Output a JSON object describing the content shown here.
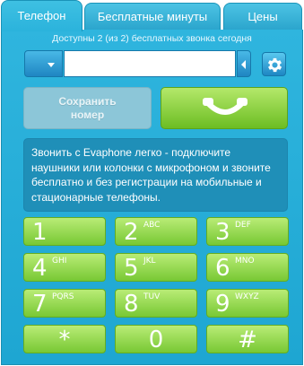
{
  "tabs": [
    {
      "label": "Телефон",
      "active": true
    },
    {
      "label": "Бесплатные минуты",
      "active": false
    },
    {
      "label": "Цены",
      "active": false
    }
  ],
  "quota_text": "Доступны 2 (из 2) бесплатных звонка сегодня",
  "dialer": {
    "number_value": "",
    "number_placeholder": ""
  },
  "save_button": {
    "line1": "Сохранить",
    "line2": "номер"
  },
  "info_text": "Звонить с Evaphone легко - подключите наушники или колонки с микрофоном и звоните бесплатно и без регистрации на мобильные и стационарные телефоны.",
  "keypad": [
    {
      "digit": "1",
      "letters": ""
    },
    {
      "digit": "2",
      "letters": "ABC"
    },
    {
      "digit": "3",
      "letters": "DEF"
    },
    {
      "digit": "4",
      "letters": "GHI"
    },
    {
      "digit": "5",
      "letters": "JKL"
    },
    {
      "digit": "6",
      "letters": "MNO"
    },
    {
      "digit": "7",
      "letters": "PQRS"
    },
    {
      "digit": "8",
      "letters": "TUV"
    },
    {
      "digit": "9",
      "letters": "WXYZ"
    },
    {
      "digit": "*",
      "letters": ""
    },
    {
      "digit": "0",
      "letters": ""
    },
    {
      "digit": "#",
      "letters": ""
    }
  ],
  "colors": {
    "panel": "#2bb3dc",
    "key_green": "#8fd443",
    "info_bg": "#1f8fb8"
  },
  "icons": {
    "country": "chevron-down-icon",
    "backspace": "chevron-left-icon",
    "settings": "gear-icon",
    "call": "handset-icon"
  }
}
